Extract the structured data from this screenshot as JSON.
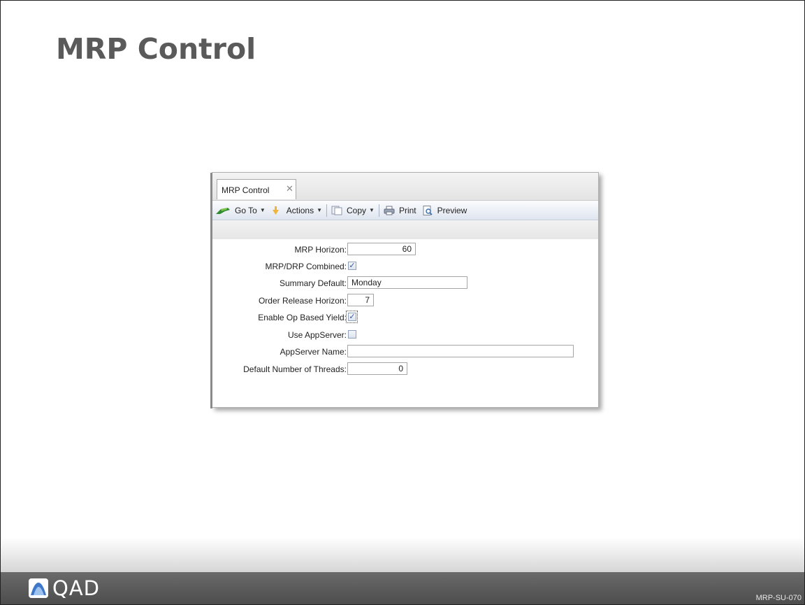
{
  "slide": {
    "title": "MRP Control",
    "logo_text": "QAD",
    "code": "MRP-SU-070"
  },
  "window": {
    "tab_label": "MRP Control",
    "tab_close": "✕",
    "toolbar": {
      "goto_label": "Go To",
      "actions_label": "Actions",
      "copy_label": "Copy",
      "print_label": "Print",
      "preview_label": "Preview",
      "dropdown_arrow": "▼"
    },
    "fields": {
      "mrp_horizon": {
        "label": "MRP Horizon:",
        "value": "60"
      },
      "mrp_drp_combined": {
        "label": "MRP/DRP Combined:",
        "checked": true
      },
      "summary_default": {
        "label": "Summary Default:",
        "value": "Monday"
      },
      "order_release_horizon": {
        "label": "Order Release Horizon:",
        "value": "7"
      },
      "enable_op_based_yield": {
        "label": "Enable Op Based Yield:",
        "checked": true
      },
      "use_appserver": {
        "label": "Use AppServer:",
        "checked": false
      },
      "appserver_name": {
        "label": "AppServer Name:",
        "value": ""
      },
      "default_threads": {
        "label": "Default Number of Threads:",
        "value": "0"
      }
    },
    "check_glyph": "✓"
  },
  "colors": {
    "title": "#5a5a5a",
    "footer": "#555555",
    "toolbar": "#dfe5ef"
  }
}
